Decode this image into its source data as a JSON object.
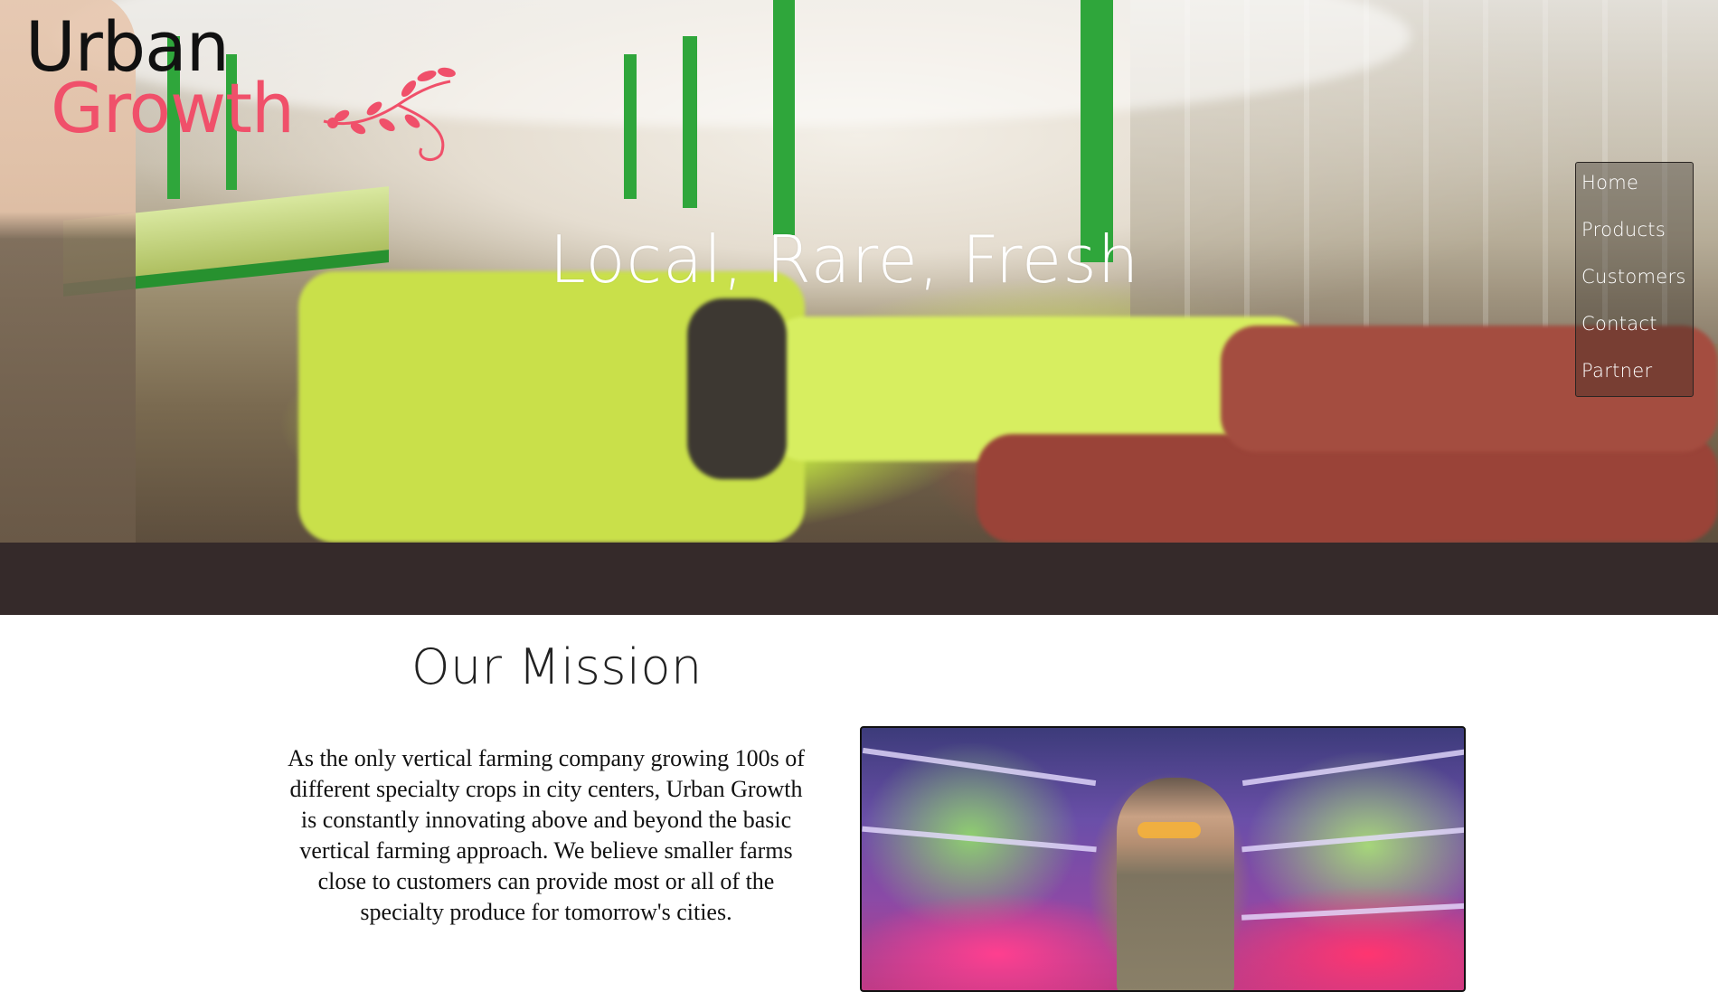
{
  "logo": {
    "line1": "Urban",
    "line2": "Growth",
    "icon": "flower-vine-icon",
    "colors": {
      "urban": "#111111",
      "growth": "#f0506a"
    }
  },
  "nav": {
    "items": [
      {
        "label": "Home"
      },
      {
        "label": "Products"
      },
      {
        "label": "Customers"
      },
      {
        "label": "Contact"
      },
      {
        "label": "Partner"
      }
    ]
  },
  "hero": {
    "title": "Local, Rare, Fresh"
  },
  "mission": {
    "heading": "Our Mission",
    "body": "As the only vertical farming company growing 100s of different specialty crops in city centers, Urban Growth is constantly innovating above and beyond the basic vertical farming approach. We believe smaller farms close to customers can provide most or all of the specialty produce for tomorrow's cities."
  },
  "colors": {
    "band": "#352a2a",
    "accent": "#f0506a"
  }
}
